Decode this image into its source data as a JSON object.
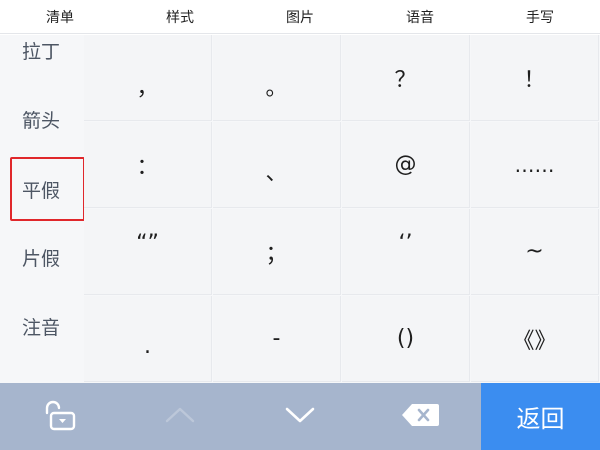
{
  "tabs": [
    {
      "label": "清单"
    },
    {
      "label": "样式"
    },
    {
      "label": "图片"
    },
    {
      "label": "语音"
    },
    {
      "label": "手写"
    }
  ],
  "sidebar": {
    "items": [
      {
        "label": "拉丁"
      },
      {
        "label": "箭头"
      },
      {
        "label": "平假",
        "selected": true
      },
      {
        "label": "片假"
      },
      {
        "label": "注音"
      }
    ]
  },
  "grid": {
    "rows": [
      [
        "，",
        "。",
        "？",
        "！"
      ],
      [
        "：",
        "、",
        "@",
        "……"
      ],
      [
        "“”",
        "；",
        "‘’",
        "~"
      ],
      [
        ".",
        "-",
        "()",
        "《》"
      ]
    ]
  },
  "toolbar": {
    "return_label": "返回",
    "icons": [
      "unlock-icon",
      "chevron-up-icon",
      "chevron-down-icon",
      "backspace-icon"
    ]
  },
  "colors": {
    "toolbar_bg": "#a6b5cd",
    "return_bg": "#3b8df0",
    "selected_border": "#e0272b",
    "grid_bg": "#f4f5f7"
  }
}
